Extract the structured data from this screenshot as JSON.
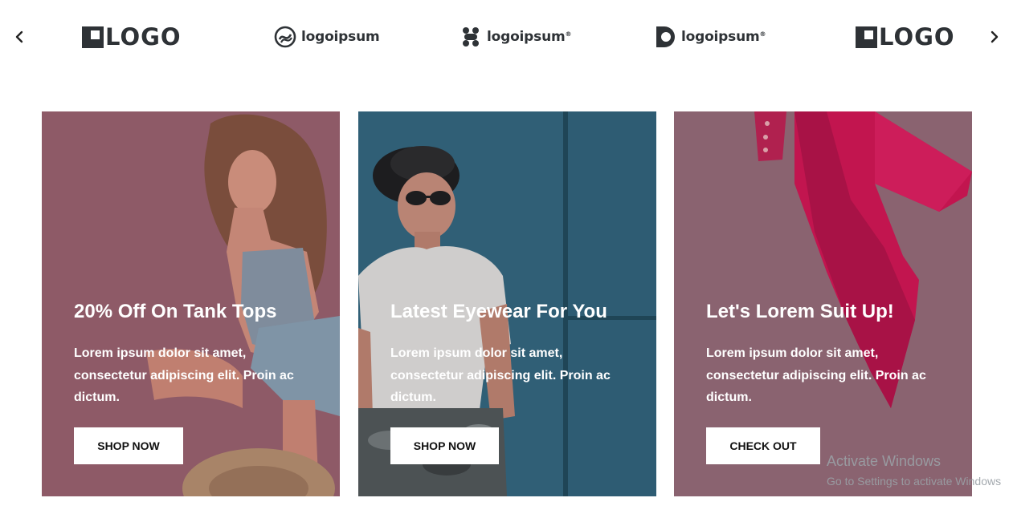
{
  "carousel": {
    "prev_icon": "chevron-left-icon",
    "next_icon": "chevron-right-icon",
    "logos": [
      {
        "text": "LOGO",
        "icon": "logo-block-icon"
      },
      {
        "text": "logoipsum",
        "icon": "logo-circle-icon"
      },
      {
        "text": "logoipsum",
        "icon": "logo-dots-icon",
        "mark": "®"
      },
      {
        "text": "logoipsum",
        "icon": "logo-half-icon",
        "mark": "®"
      },
      {
        "text": "LOGO",
        "icon": "logo-block-icon"
      }
    ]
  },
  "cards": [
    {
      "title": "20% Off On Tank Tops",
      "description": "Lorem ipsum dolor sit amet, consectetur adipiscing elit. Proin ac dictum.",
      "button": "SHOP NOW",
      "overlay_color": "#8a5663"
    },
    {
      "title": "Latest Eyewear For You",
      "description": "Lorem ipsum dolor sit amet, consectetur adipiscing elit. Proin ac dictum.",
      "button": "SHOP NOW",
      "overlay_color": "#2f5a70"
    },
    {
      "title": "Let's Lorem Suit Up!",
      "description": "Lorem ipsum dolor sit amet, consectetur adipiscing elit. Proin ac dictum.",
      "button": "CHECK OUT",
      "overlay_color": "#86606c"
    }
  ],
  "watermark": {
    "title": "Activate Windows",
    "subtitle": "Go to Settings to activate Windows"
  }
}
